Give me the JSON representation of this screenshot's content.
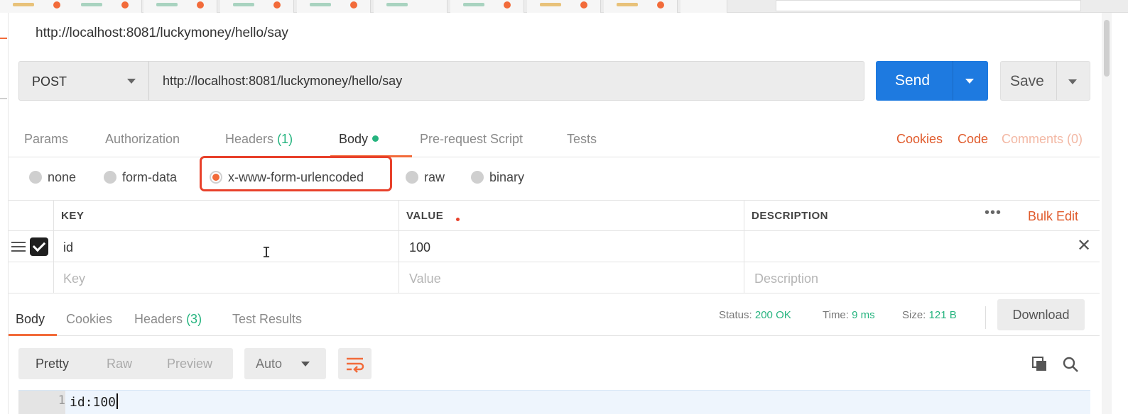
{
  "request": {
    "title": "http://localhost:8081/luckymoney/hello/say",
    "method": "POST",
    "url": "http://localhost:8081/luckymoney/hello/say",
    "send_label": "Send",
    "save_label": "Save"
  },
  "request_tabs": {
    "params": "Params",
    "authorization": "Authorization",
    "headers": "Headers",
    "headers_count": "(1)",
    "body": "Body",
    "prerequest": "Pre-request Script",
    "tests": "Tests",
    "cookies": "Cookies",
    "code": "Code",
    "comments": "Comments (0)"
  },
  "body_modes": {
    "none": "none",
    "form_data": "form-data",
    "urlencoded": "x-www-form-urlencoded",
    "raw": "raw",
    "binary": "binary",
    "selected": "x-www-form-urlencoded"
  },
  "table": {
    "headers": {
      "key": "KEY",
      "value": "VALUE",
      "description": "DESCRIPTION"
    },
    "bulk_edit": "Bulk Edit",
    "more": "•••",
    "rows": [
      {
        "key": "id",
        "value": "100",
        "description": "",
        "checked": true
      }
    ],
    "placeholders": {
      "key": "Key",
      "value": "Value",
      "description": "Description"
    }
  },
  "response": {
    "tabs": {
      "body": "Body",
      "cookies": "Cookies",
      "headers": "Headers",
      "headers_count": "(3)",
      "test_results": "Test Results"
    },
    "status_label": "Status:",
    "status_value": "200 OK",
    "time_label": "Time:",
    "time_value": "9 ms",
    "size_label": "Size:",
    "size_value": "121 B",
    "download_label": "Download",
    "view": {
      "pretty": "Pretty",
      "raw": "Raw",
      "preview": "Preview"
    },
    "format": "Auto",
    "line_number": "1",
    "code_line": "id:100"
  },
  "colors": {
    "accent": "#f26b3a",
    "send_blue": "#1e7ae0",
    "success_green": "#26b47f",
    "highlight_red": "#e8412b"
  }
}
